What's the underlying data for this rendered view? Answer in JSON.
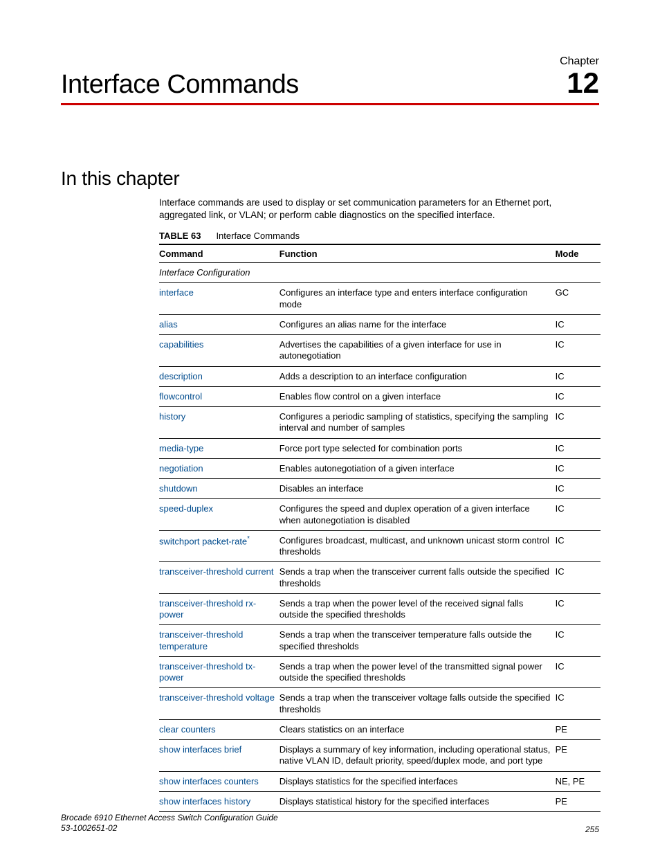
{
  "header": {
    "chapter_label": "Chapter",
    "title": "Interface Commands",
    "number": "12"
  },
  "section": {
    "title": "In this chapter",
    "intro": "Interface commands are used to display or set communication parameters for an Ethernet port, aggregated link, or VLAN; or perform cable diagnostics on the specified interface."
  },
  "table": {
    "label": "TABLE 63",
    "caption": "Interface Commands",
    "headers": {
      "command": "Command",
      "function": "Function",
      "mode": "Mode"
    },
    "section_row": "Interface Configuration",
    "rows": [
      {
        "cmd": "interface",
        "star": false,
        "func": "Configures an interface type and enters interface configuration mode",
        "mode": "GC"
      },
      {
        "cmd": "alias",
        "star": false,
        "func": "Configures an alias name for the interface",
        "mode": "IC"
      },
      {
        "cmd": "capabilities",
        "star": false,
        "func": "Advertises the capabilities of a given interface for use in autonegotiation",
        "mode": "IC"
      },
      {
        "cmd": "description",
        "star": false,
        "func": "Adds a description to an interface configuration",
        "mode": "IC"
      },
      {
        "cmd": "flowcontrol",
        "star": false,
        "func": "Enables flow control on a given interface",
        "mode": "IC"
      },
      {
        "cmd": "history",
        "star": false,
        "func": "Configures a periodic sampling of statistics, specifying the sampling interval and number of samples",
        "mode": "IC"
      },
      {
        "cmd": "media-type",
        "star": false,
        "func": "Force port type selected for combination ports",
        "mode": "IC"
      },
      {
        "cmd": "negotiation",
        "star": false,
        "func": "Enables autonegotiation of a given interface",
        "mode": "IC"
      },
      {
        "cmd": "shutdown",
        "star": false,
        "func": "Disables an interface",
        "mode": "IC"
      },
      {
        "cmd": "speed-duplex",
        "star": false,
        "func": "Configures the speed and duplex operation of a given interface when autonegotiation is disabled",
        "mode": "IC"
      },
      {
        "cmd": "switchport packet-rate",
        "star": true,
        "func": "Configures broadcast, multicast, and unknown unicast storm control thresholds",
        "mode": "IC"
      },
      {
        "cmd": "transceiver-threshold current",
        "star": false,
        "func": "Sends a trap when the transceiver current falls outside the specified thresholds",
        "mode": "IC"
      },
      {
        "cmd": "transceiver-threshold rx-power",
        "star": false,
        "func": "Sends a trap when the power level of the received signal falls outside the specified thresholds",
        "mode": "IC"
      },
      {
        "cmd": "transceiver-threshold temperature",
        "star": false,
        "func": "Sends a trap when the transceiver temperature falls outside the specified thresholds",
        "mode": "IC"
      },
      {
        "cmd": "transceiver-threshold tx-power",
        "star": false,
        "func": "Sends a trap when the power level of the transmitted signal power outside the specified thresholds",
        "mode": "IC"
      },
      {
        "cmd": "transceiver-threshold voltage",
        "star": false,
        "func": "Sends a trap when the transceiver voltage falls outside the specified thresholds",
        "mode": "IC"
      },
      {
        "cmd": "clear counters",
        "star": false,
        "func": "Clears statistics on an interface",
        "mode": "PE"
      },
      {
        "cmd": "show interfaces brief",
        "star": false,
        "func": "Displays a summary of key information, including operational status, native VLAN ID, default priority, speed/duplex mode, and port type",
        "mode": "PE"
      },
      {
        "cmd": "show interfaces counters",
        "star": false,
        "func": "Displays statistics for the specified interfaces",
        "mode": "NE, PE"
      },
      {
        "cmd": "show interfaces history",
        "star": false,
        "func": "Displays statistical history for the specified interfaces",
        "mode": "PE"
      }
    ]
  },
  "footer": {
    "doc": "Brocade 6910 Ethernet Access Switch Configuration Guide",
    "docnum": "53-1002651-02",
    "page": "255"
  }
}
